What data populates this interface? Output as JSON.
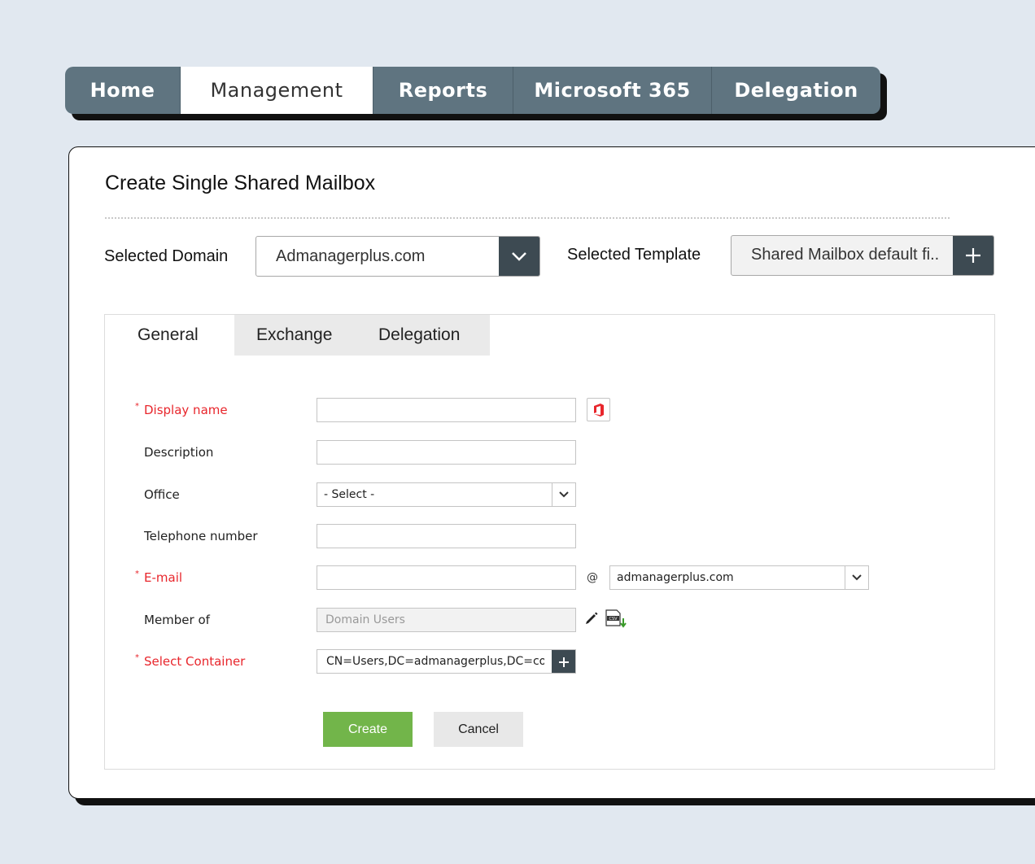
{
  "nav": {
    "tabs": [
      {
        "label": "Home"
      },
      {
        "label": "Management"
      },
      {
        "label": "Reports"
      },
      {
        "label": "Microsoft 365"
      },
      {
        "label": "Delegation"
      }
    ],
    "active": "Management"
  },
  "panel": {
    "title": "Create Single Shared Mailbox",
    "selected_domain_label": "Selected Domain",
    "selected_domain_value": "Admanagerplus.com",
    "selected_template_label": "Selected Template",
    "selected_template_value": "Shared Mailbox default fi.."
  },
  "inner_tabs": [
    {
      "label": "General"
    },
    {
      "label": "Exchange"
    },
    {
      "label": "Delegation"
    }
  ],
  "form": {
    "display_name": {
      "label": "Display name",
      "value": ""
    },
    "description": {
      "label": "Description",
      "value": ""
    },
    "office": {
      "label": "Office",
      "value": "- Select -"
    },
    "telephone": {
      "label": "Telephone number",
      "value": ""
    },
    "email": {
      "label": "E-mail",
      "value": "",
      "at": "@",
      "domain": "admanagerplus.com"
    },
    "member_of": {
      "label": "Member of",
      "value": "Domain Users"
    },
    "container": {
      "label": "Select Container",
      "value": "CN=Users,DC=admanagerplus,DC=com"
    }
  },
  "buttons": {
    "create": "Create",
    "cancel": "Cancel"
  },
  "colors": {
    "nav_bg": "#5f7480",
    "dark_button": "#3d4a52",
    "required": "#e8262c",
    "create_button": "#72b54a",
    "office_icon": "#e8262c"
  }
}
